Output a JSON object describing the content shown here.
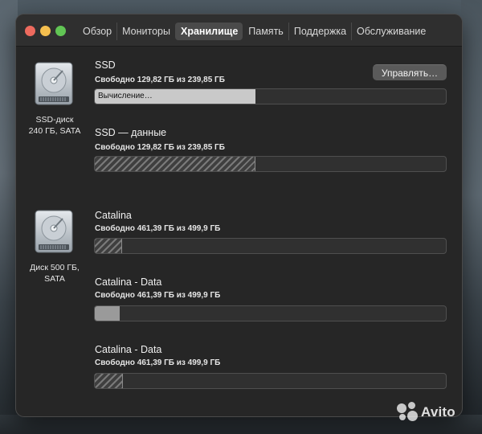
{
  "window": {
    "tabs": [
      "Обзор",
      "Мониторы",
      "Хранилище",
      "Память",
      "Поддержка",
      "Обслуживание"
    ],
    "active_tab": "Хранилище"
  },
  "drives": [
    {
      "label": "SSD-диск\n240 ГБ, SATA",
      "icon": "hard-drive-icon",
      "volumes": [
        {
          "name": "SSD",
          "free_text": "Свободно 129,82 ГБ из 239,85 ГБ",
          "bar_text": "Вычисление…",
          "used_fraction": 0.457,
          "fill": "light"
        },
        {
          "name": "SSD — данные",
          "free_text": "Свободно 129,82 ГБ из 239,85 ГБ",
          "used_fraction": 0.457,
          "fill": "hatch"
        }
      ]
    },
    {
      "label": "Диск 500 ГБ,\nSATA",
      "icon": "hard-drive-icon",
      "volumes": [
        {
          "name": "Catalina",
          "free_text": "Свободно 461,39 ГБ из 499,9 ГБ",
          "used_fraction": 0.077,
          "fill": "hatch"
        },
        {
          "name": "Catalina - Data",
          "free_text": "Свободно 461,39 ГБ из 499,9 ГБ",
          "used_fraction": 0.071,
          "fill": "solid"
        },
        {
          "name": "Catalina - Data",
          "free_text": "Свободно 461,39 ГБ из 499,9 ГБ",
          "used_fraction": 0.08,
          "fill": "hatch"
        }
      ]
    }
  ],
  "manage_button": "Управлять…",
  "watermark": "Avito",
  "colors": {
    "window_bg": "#262626",
    "titlebar_bg": "#2f2f2f",
    "close": "#ed6a5e",
    "minimize": "#f5bf4f",
    "maximize": "#61c554"
  }
}
